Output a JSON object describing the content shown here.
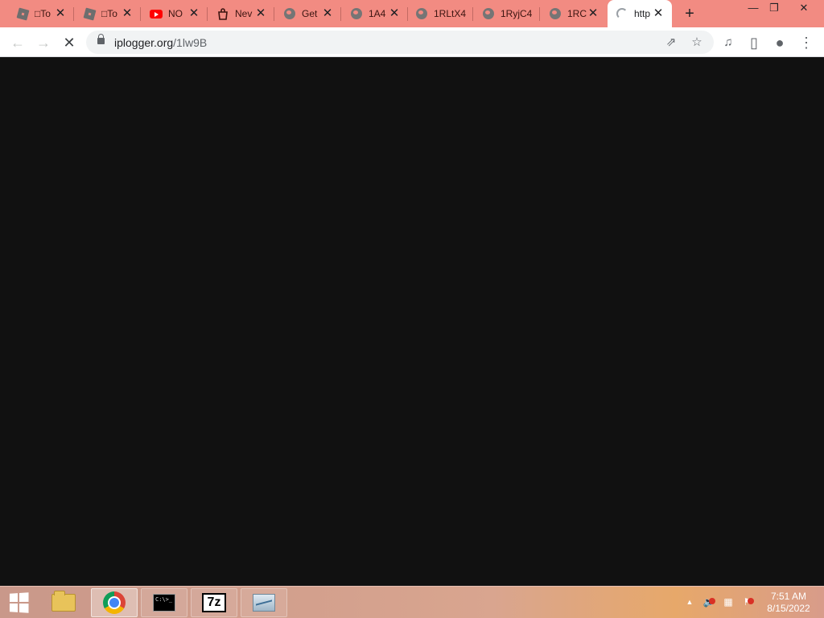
{
  "tabs": [
    {
      "icon": "roblox-icon",
      "title": "□To",
      "close": "✕"
    },
    {
      "icon": "roblox-icon",
      "title": "□To",
      "close": "✕"
    },
    {
      "icon": "youtube-icon",
      "title": "NO",
      "close": "✕"
    },
    {
      "icon": "bag-icon",
      "title": "Nev",
      "close": "✕"
    },
    {
      "icon": "globe-icon",
      "title": "Get",
      "close": "✕"
    },
    {
      "icon": "globe-icon",
      "title": "1A4",
      "close": "✕"
    },
    {
      "icon": "globe-icon",
      "title": "1RLtX4",
      "close": "✕"
    },
    {
      "icon": "globe-icon",
      "title": "1RyjC4",
      "close": "✕"
    },
    {
      "icon": "globe-icon",
      "title": "1RC",
      "close": "✕"
    },
    {
      "icon": "loading-icon",
      "title": "http",
      "close": "✕",
      "active": true
    }
  ],
  "new_tab": "+",
  "window_controls": {
    "minimize": "—",
    "restore": "❐",
    "close": "✕"
  },
  "toolbar": {
    "back": "←",
    "forward": "→",
    "stop": "✕",
    "url_host": "iplogger.org",
    "url_path": "/1lw9B",
    "share": "⇗",
    "bookmark": "☆",
    "media": "♫",
    "sidepanel": "▯",
    "profile": "●",
    "menu": "⋮"
  },
  "taskbar": {
    "apps": [
      "file-explorer",
      "google-chrome",
      "command-prompt",
      "7-zip",
      "resource-monitor"
    ],
    "seven_zip_label": "7z",
    "cmd_label": "C:\\>_",
    "tray": {
      "show_hidden": "▲",
      "volume": "🔈",
      "network": "▦",
      "action_center": "⚑"
    },
    "clock_time": "7:51 AM",
    "clock_date": "8/15/2022"
  },
  "colors": {
    "tab_strip": "#f28b82",
    "content_bg": "#111111"
  }
}
